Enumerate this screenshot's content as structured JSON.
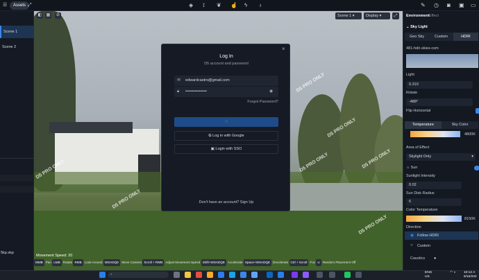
{
  "topbar": {
    "assets_label": "Assets",
    "icons": [
      "drop-icon",
      "path-icon",
      "leaf-icon",
      "pointer-icon",
      "bolt-icon",
      "planet-icon",
      "edit-icon",
      "camera-icon",
      "photo-icon",
      "window-icon"
    ]
  },
  "sidebar": {
    "scenes": [
      {
        "label": "Scene 1",
        "active": true
      },
      {
        "label": "Scene 2",
        "active": false
      }
    ]
  },
  "viewport": {
    "scene_label": "Scene 1",
    "display_label": "Display",
    "movement_speed": "Movement Speed: 20",
    "watermark": "D5 PRO ONLY"
  },
  "login": {
    "title": "Log In",
    "subtitle": "D5 account and password",
    "email": "edwardcastro@gmail.com",
    "password": "••••••••••••••••",
    "forgot": "Forgot Password?",
    "google": "Log in with Google",
    "sso": "Login with SSO",
    "signup": "Don't have an account? Sign Up"
  },
  "status": [
    [
      "MMB",
      "Pan"
    ],
    [
      "LMB",
      "Rotate"
    ],
    [
      "RMB",
      "Look Around"
    ],
    [
      "WSADQE",
      "Move Camera"
    ],
    [
      "Scroll + RMB",
      "Adjust Movement Speed"
    ],
    [
      "Shift+WSADQE",
      "Accelerate"
    ],
    [
      "Space+WSADQE",
      "Decelerate"
    ],
    [
      "Ctrl + Scroll",
      "Fov"
    ],
    [
      "U",
      "Random Placement Off"
    ]
  ],
  "file_label": "5kp.skp",
  "right": {
    "tabs": [
      "Environment",
      "Effect"
    ],
    "section": "Sky Light",
    "sky_tabs": [
      "Geo Sky",
      "Custom",
      "HDRI"
    ],
    "hdri_name": "481-hdri-skies-com",
    "light_label": "Light",
    "light_value": "0.310",
    "rotate_label": "Rotate",
    "rotate_value": "-488°",
    "flip_label": "Flip Horizontal",
    "temp_tabs": [
      "Temperature",
      "Sky Color"
    ],
    "temp_value": "4800K",
    "area_label": "Area of Effect",
    "area_value": "Skylight Only",
    "sun_label": "Sun",
    "sun_intensity_label": "Sunlight Intensity",
    "sun_intensity_value": "0.02",
    "disk_label": "Sun Disk Radius",
    "disk_value": "6",
    "color_temp_label": "Color Temperature",
    "color_temp_value": "8150K",
    "direction_label": "Direction",
    "follow_label": "Follow HDRI",
    "custom_label": "Custom",
    "caustics_label": "Caustics"
  },
  "taskbar": {
    "lang": "ENG",
    "region": "US",
    "time": "10:12 A",
    "date": "6/15/202"
  }
}
